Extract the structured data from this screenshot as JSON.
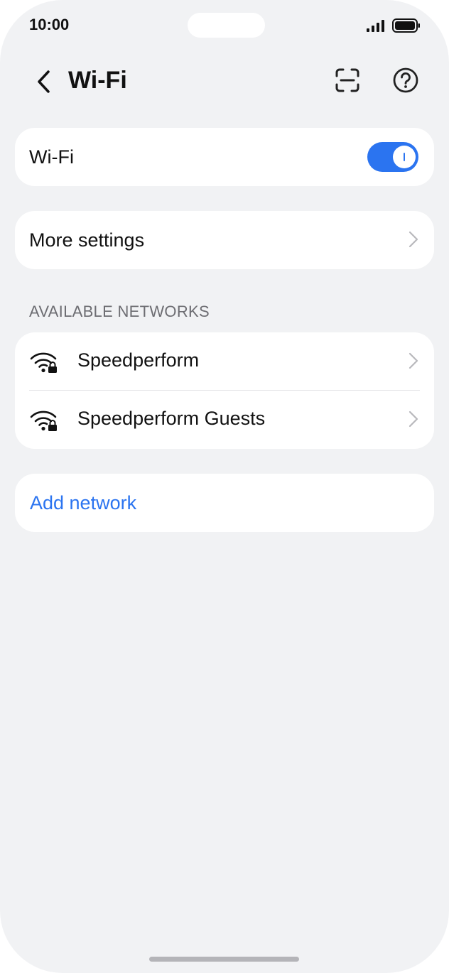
{
  "status": {
    "time": "10:00"
  },
  "header": {
    "title": "Wi-Fi"
  },
  "wifi_row": {
    "label": "Wi-Fi",
    "enabled": true
  },
  "more_settings": {
    "label": "More settings"
  },
  "networks_section": {
    "heading": "AVAILABLE NETWORKS",
    "items": [
      {
        "name": "Speedperform",
        "icon": "wifi-lock-icon"
      },
      {
        "name": "Speedperform Guests",
        "icon": "wifi-lock-icon"
      }
    ]
  },
  "add_network": {
    "label": "Add network"
  },
  "colors": {
    "accent": "#2b74f0",
    "background": "#f1f2f4",
    "card": "#ffffff"
  }
}
